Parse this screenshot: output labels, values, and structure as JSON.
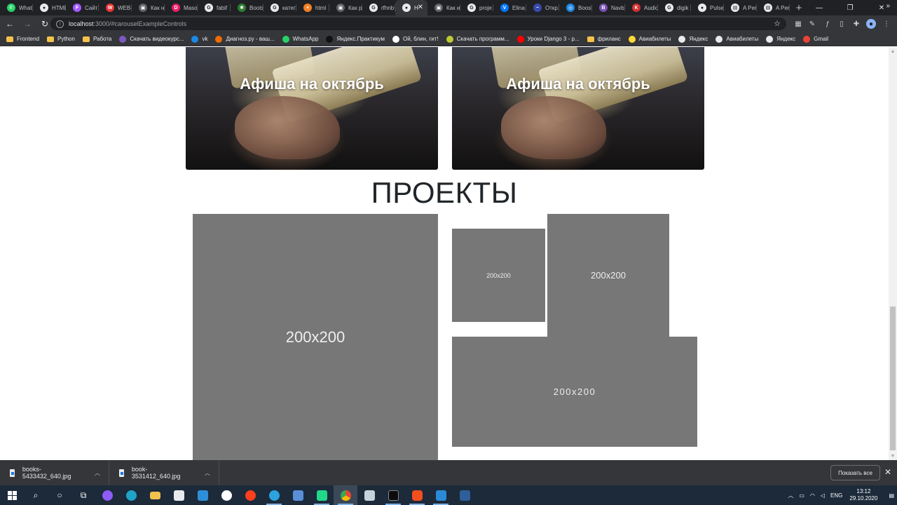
{
  "browser": {
    "tabs": [
      {
        "label": "What",
        "color": "#25d366",
        "glyph": "✆"
      },
      {
        "label": "HTML",
        "color": "#e8eaed",
        "glyph": "●"
      },
      {
        "label": "Сайт",
        "color": "#a259ff",
        "glyph": "F"
      },
      {
        "label": "WEB-",
        "color": "#e53935",
        "glyph": "W"
      },
      {
        "label": "Как н",
        "color": "#5f6368",
        "glyph": "▣"
      },
      {
        "label": "Maso",
        "color": "#e91e63",
        "glyph": "D"
      },
      {
        "label": "fabif",
        "color": "#e8eaed",
        "glyph": "G"
      },
      {
        "label": "Boots",
        "color": "#2e7d32",
        "glyph": "✱"
      },
      {
        "label": "катег",
        "color": "#e8eaed",
        "glyph": "G"
      },
      {
        "label": "html",
        "color": "#f48024",
        "glyph": "≡"
      },
      {
        "label": "Как р",
        "color": "#5f6368",
        "glyph": "▣"
      },
      {
        "label": "rfhnb",
        "color": "#e8eaed",
        "glyph": "G"
      },
      {
        "label": "Н",
        "color": "#e8eaed",
        "glyph": "●",
        "active": true
      },
      {
        "label": "Как и",
        "color": "#5f6368",
        "glyph": "▣"
      },
      {
        "label": "proje",
        "color": "#e8eaed",
        "glyph": "G"
      },
      {
        "label": "Elina",
        "color": "#0077ff",
        "glyph": "V"
      },
      {
        "label": "Откр",
        "color": "#3949ab",
        "glyph": "~"
      },
      {
        "label": "Boost",
        "color": "#1e88e5",
        "glyph": "◎"
      },
      {
        "label": "Navb",
        "color": "#7952b3",
        "glyph": "B"
      },
      {
        "label": "Audio",
        "color": "#d32f2f",
        "glyph": "K"
      },
      {
        "label": "digik",
        "color": "#e8eaed",
        "glyph": "G"
      },
      {
        "label": "Pulse",
        "color": "#e8eaed",
        "glyph": "●"
      },
      {
        "label": "A Per",
        "color": "#e8eaed",
        "glyph": "▤"
      },
      {
        "label": "A Per",
        "color": "#e8eaed",
        "glyph": "▤"
      }
    ],
    "url_host": "localhost",
    "url_rest": ":3000/#carouselExampleControls",
    "bookmarks": [
      {
        "label": "Frontend",
        "type": "folder"
      },
      {
        "label": "Python",
        "type": "folder"
      },
      {
        "label": "Работа",
        "type": "folder"
      },
      {
        "label": "Скачать видеокурс...",
        "type": "site",
        "color": "#7e57c2"
      },
      {
        "label": "vk",
        "type": "site",
        "color": "#1e88e5"
      },
      {
        "label": "Диагноз.ру - ваш...",
        "type": "site",
        "color": "#ef6c00"
      },
      {
        "label": "WhatsApp",
        "type": "site",
        "color": "#25d366"
      },
      {
        "label": "Яндекс.Практикум",
        "type": "site",
        "color": "#111111"
      },
      {
        "label": "Ой, блин, гит!",
        "type": "site",
        "color": "#ffffff"
      },
      {
        "label": "Скачать программ...",
        "type": "site",
        "color": "#c0ca33"
      },
      {
        "label": "Уроки Django 3 - р...",
        "type": "site",
        "color": "#ff0000"
      },
      {
        "label": "фриланс",
        "type": "folder"
      },
      {
        "label": "Авиабилеты",
        "type": "site",
        "color": "#fdd835"
      },
      {
        "label": "Яндекс",
        "type": "site",
        "color": "#e8eaed"
      },
      {
        "label": "Авиабилеты",
        "type": "site",
        "color": "#e8eaed"
      },
      {
        "label": "Яндекс",
        "type": "site",
        "color": "#e8eaed"
      },
      {
        "label": "Gmail",
        "type": "site",
        "color": "#ea4335"
      }
    ]
  },
  "page": {
    "cards": [
      {
        "title": "Афиша на октябрь"
      },
      {
        "title": "Афиша на октябрь"
      }
    ],
    "projects_title": "ПРОЕКТЫ",
    "placeholders": [
      "200x200",
      "200x200",
      "200x200",
      "200x200"
    ],
    "placeholder_color": "#777777"
  },
  "downloads": {
    "items": [
      "books-5433432_640.jpg",
      "book-3531412_640.jpg"
    ],
    "show_all": "Показать все"
  },
  "taskbar": {
    "lang": "ENG",
    "time": "13:12",
    "date": "29.10.2020"
  }
}
